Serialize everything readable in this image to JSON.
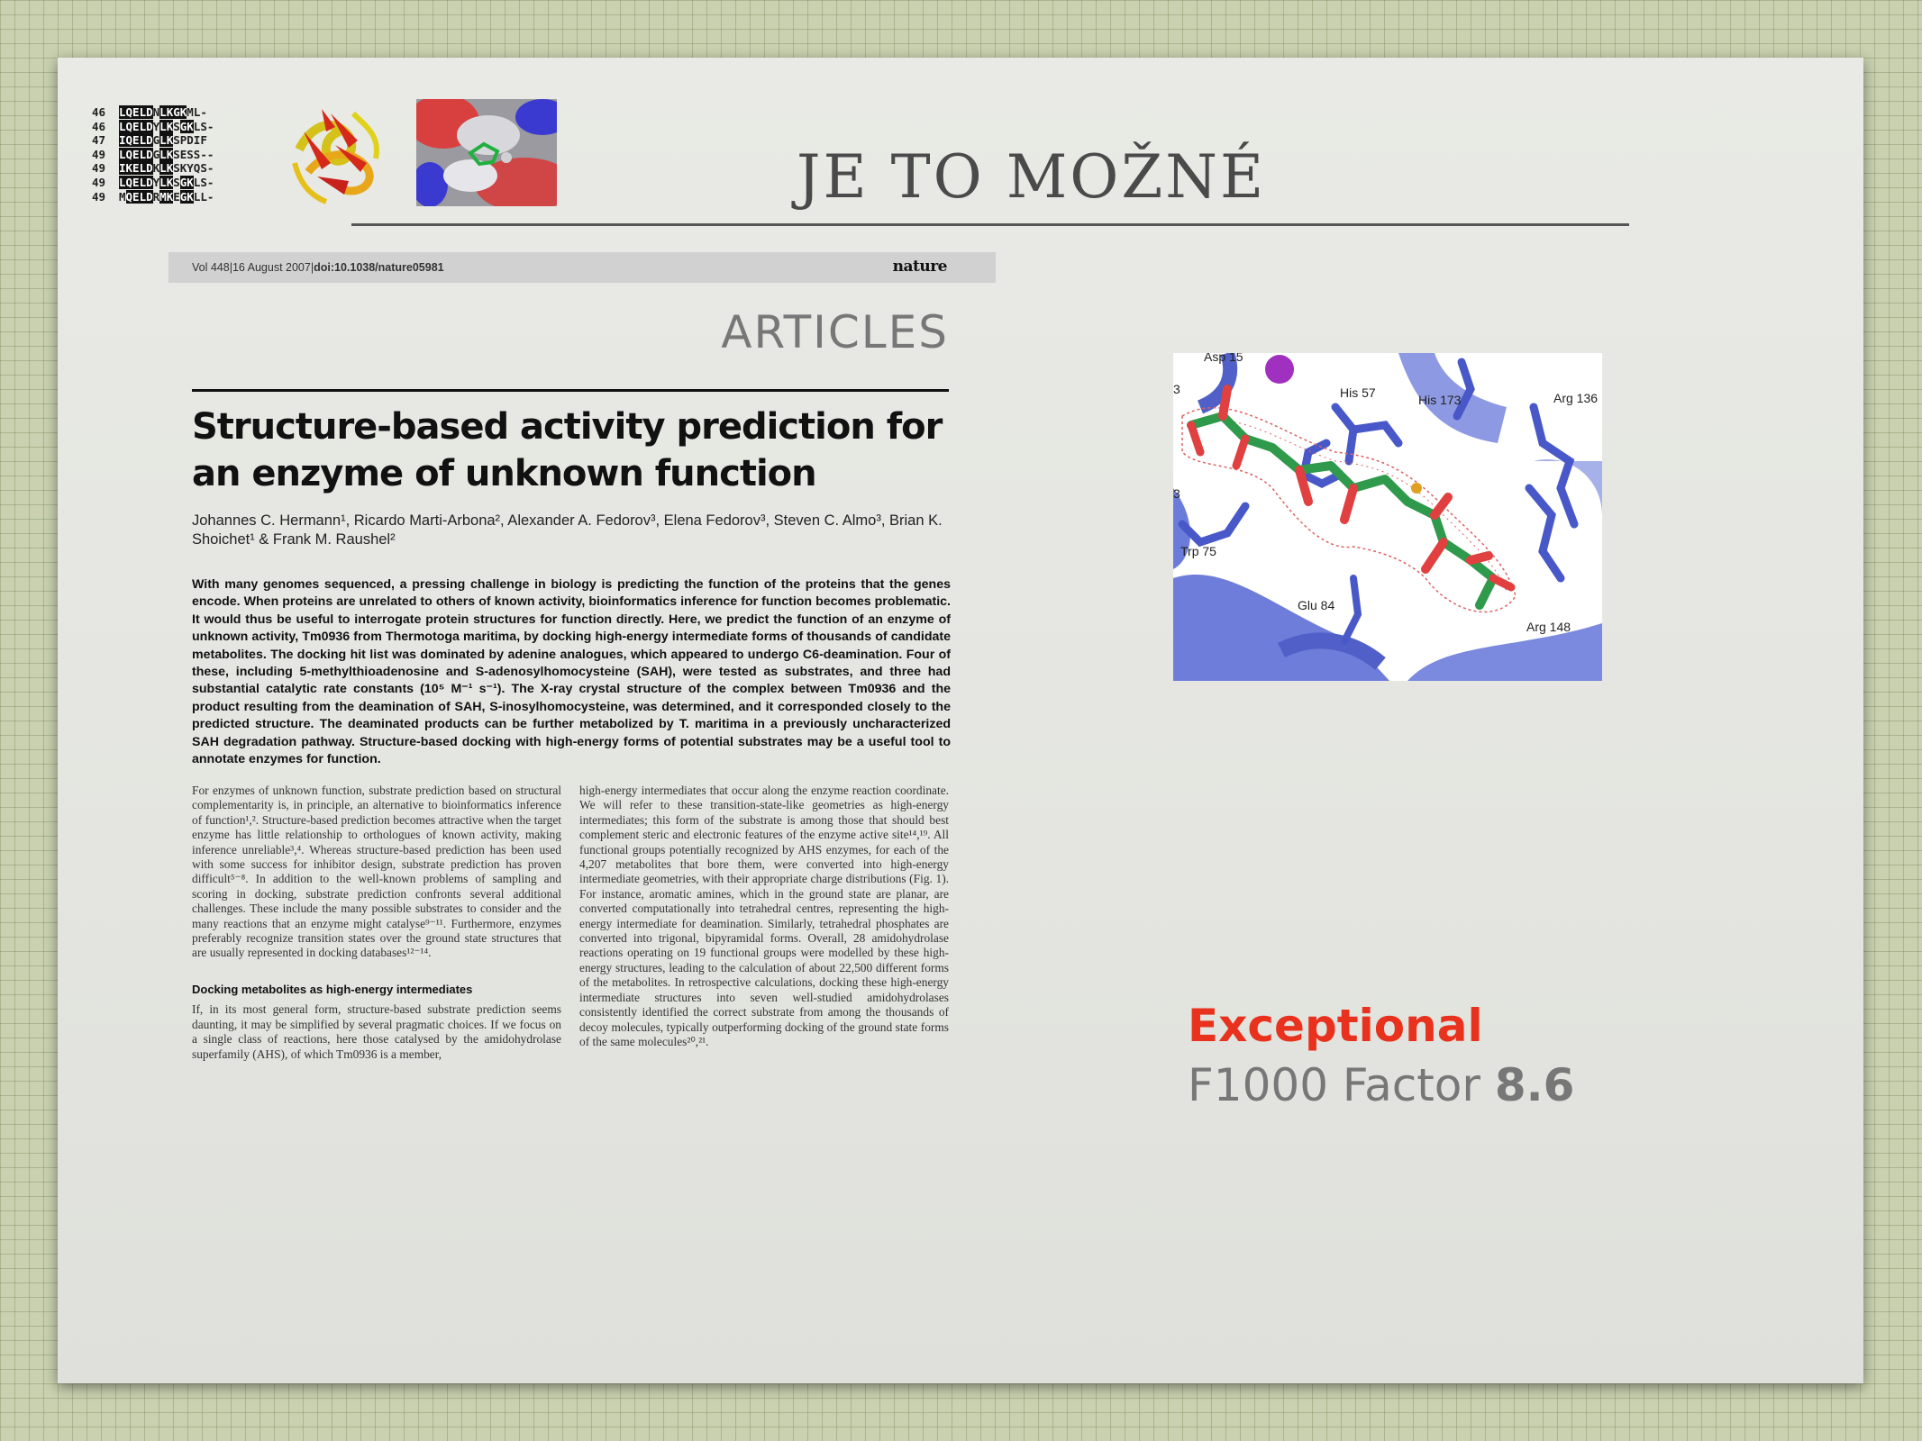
{
  "slide": {
    "title": "JE TO MOŽNÉ"
  },
  "sequence_alignment": {
    "rows": [
      {
        "num": "46",
        "pre": "",
        "blk1": "LQELD",
        "mid": "N",
        "blk2": "LK",
        "mid2": "",
        "blk3": "GK",
        "post": "ML-"
      },
      {
        "num": "46",
        "pre": "",
        "blk1": "LQELD",
        "mid": "Y",
        "blk2": "LK",
        "mid2": "S",
        "blk3": "GK",
        "post": "LS-"
      },
      {
        "num": "47",
        "pre": "",
        "blk1": "IQELD",
        "mid": "G",
        "blk2": "LK",
        "mid2": "",
        "blk3": "",
        "post": "SPDIF"
      },
      {
        "num": "49",
        "pre": "",
        "blk1": "LQELD",
        "mid": "G",
        "blk2": "LK",
        "mid2": "",
        "blk3": "",
        "post": "SESS--"
      },
      {
        "num": "49",
        "pre": "",
        "blk1": "IKELD",
        "mid": "K",
        "blk2": "LK",
        "mid2": "",
        "blk3": "",
        "post": "SKYQS-"
      },
      {
        "num": "49",
        "pre": "",
        "blk1": "LQELD",
        "mid": "Y",
        "blk2": "LK",
        "mid2": "S",
        "blk3": "GK",
        "post": "LS-"
      },
      {
        "num": "49",
        "pre": "M",
        "blk1": "QELD",
        "mid": "R",
        "blk2": "MK",
        "mid2": "E",
        "blk3": "GK",
        "post": "LL-"
      }
    ]
  },
  "article": {
    "volume": "Vol 448|16 August 2007|",
    "doi": "doi:10.1038/nature05981",
    "journal": "nature",
    "section": "ARTICLES",
    "title": "Structure-based activity prediction for an enzyme of unknown function",
    "authors": "Johannes C. Hermann¹, Ricardo Marti-Arbona², Alexander A. Fedorov³, Elena Fedorov³, Steven C. Almo³, Brian K. Shoichet¹ & Frank M. Raushel²",
    "abstract": "With many genomes sequenced, a pressing challenge in biology is predicting the function of the proteins that the genes encode. When proteins are unrelated to others of known activity, bioinformatics inference for function becomes problematic. It would thus be useful to interrogate protein structures for function directly. Here, we predict the function of an enzyme of unknown activity, Tm0936 from Thermotoga maritima, by docking high-energy intermediate forms of thousands of candidate metabolites. The docking hit list was dominated by adenine analogues, which appeared to undergo C6-deamination. Four of these, including 5-methylthioadenosine and S-adenosylhomocysteine (SAH), were tested as substrates, and three had substantial catalytic rate constants (10⁵ M⁻¹ s⁻¹). The X-ray crystal structure of the complex between Tm0936 and the product resulting from the deamination of SAH, S-inosylhomocysteine, was determined, and it corresponded closely to the predicted structure. The deaminated products can be further metabolized by T. maritima in a previously uncharacterized SAH degradation pathway. Structure-based docking with high-energy forms of potential substrates may be a useful tool to annotate enzymes for function.",
    "col_left_p1": "For enzymes of unknown function, substrate prediction based on structural complementarity is, in principle, an alternative to bioinformatics inference of function¹,². Structure-based prediction becomes attractive when the target enzyme has little relationship to orthologues of known activity, making inference unreliable³,⁴. Whereas structure-based prediction has been used with some success for inhibitor design, substrate prediction has proven difficult⁵⁻⁸. In addition to the well-known problems of sampling and scoring in docking, substrate prediction confronts several additional challenges. These include the many possible substrates to consider and the many reactions that an enzyme might catalyse⁹⁻¹¹. Furthermore, enzymes preferably recognize transition states over the ground state structures that are usually represented in docking databases¹²⁻¹⁴.",
    "col_left_heading": "Docking metabolites as high-energy intermediates",
    "col_left_p2": "If, in its most general form, structure-based substrate prediction seems daunting, it may be simplified by several pragmatic choices. If we focus on a single class of reactions, here those catalysed by the amidohydrolase superfamily (AHS), of which Tm0936 is a member,",
    "col_right_p1": "high-energy intermediates that occur along the enzyme reaction coordinate. We will refer to these transition-state-like geometries as high-energy intermediates; this form of the substrate is among those that should best complement steric and electronic features of the enzyme active site¹⁴,¹⁹. All functional groups potentially recognized by AHS enzymes, for each of the 4,207 metabolites that bore them, were converted into high-energy intermediate geometries, with their appropriate charge distributions (Fig. 1). For instance, aromatic amines, which in the ground state are planar, are converted computationally into tetrahedral centres, representing the high-energy intermediate for deamination. Similarly, tetrahedral phosphates are converted into trigonal, bipyramidal forms. Overall, 28 amidohydrolase reactions operating on 19 functional groups were modelled by these high-energy structures, leading to the calculation of about 22,500 different forms of the metabolites. In retrospective calculations, docking these high-energy intermediate structures into seven well-studied amidohydrolases consistently identified the correct substrate from among the thousands of decoy molecules, typically outperforming docking of the ground state forms of the same molecules²⁰,²¹."
  },
  "structure_figure": {
    "labels": {
      "asp": "Asp 15",
      "his57": "His 57",
      "his173": "His 173",
      "arg136": "Arg 136",
      "trp75": "Trp 75",
      "glu84": "Glu 84",
      "arg148": "Arg 148",
      "left_top": "3",
      "left_mid": "3"
    }
  },
  "rating": {
    "label": "Exceptional",
    "factor_text": "F1000 Factor ",
    "factor_value": "8.6"
  },
  "colors": {
    "accent_red": "#e8321e",
    "protein_blue": "#5e6fd6",
    "ligand_green": "#2f9a4b",
    "ligand_red": "#e04040"
  }
}
